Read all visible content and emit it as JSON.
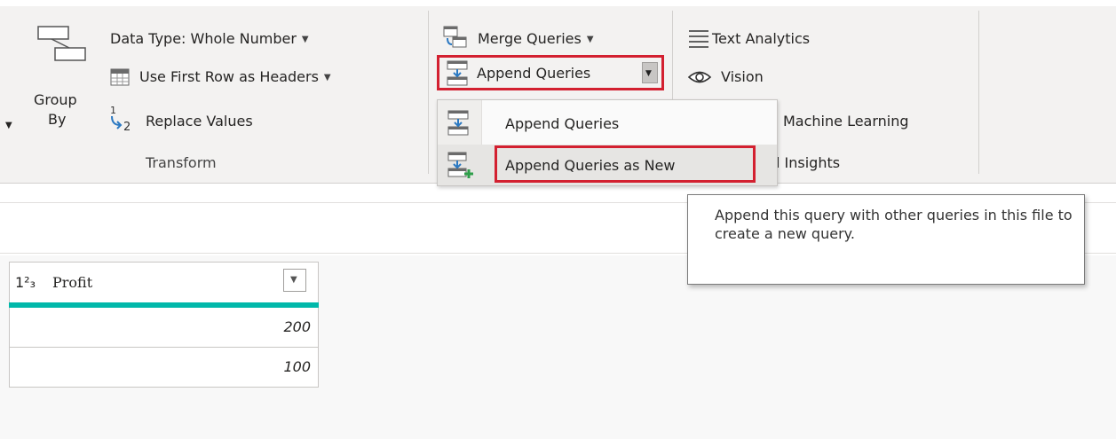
{
  "ribbon": {
    "group_by": {
      "line1": "Group",
      "line2": "By"
    },
    "transform": {
      "data_type_label": "Data Type: Whole Number",
      "first_row_label": "Use First Row as Headers",
      "replace_values_label": "Replace Values",
      "group_label": "Transform"
    },
    "combine": {
      "merge_label": "Merge Queries",
      "append_label": "Append Queries"
    },
    "ai": {
      "text_analytics_label": "Text Analytics",
      "vision_label": "Vision",
      "azure_ml_partial": "Machine Learning",
      "ai_insights_partial": "l Insights"
    }
  },
  "append_menu": {
    "items": [
      {
        "label": "Append Queries"
      },
      {
        "label": "Append Queries as New"
      }
    ]
  },
  "tooltip": {
    "text": "Append this query with other queries in this file to create a new query."
  },
  "table": {
    "column": {
      "type_glyph": "1²₃",
      "name": "Profit"
    },
    "rows": [
      "200",
      "100"
    ]
  },
  "colors": {
    "highlight": "#d32030",
    "column_accent": "#01b8aa",
    "ribbon_bg": "#f3f2f1"
  },
  "icons": [
    "group-by-icon",
    "data-type-icon",
    "table-headers-icon",
    "replace-values-icon",
    "merge-queries-icon",
    "append-queries-icon",
    "append-as-new-icon",
    "text-analytics-icon",
    "vision-icon",
    "dropdown-caret-icon",
    "filter-dropdown-icon"
  ]
}
